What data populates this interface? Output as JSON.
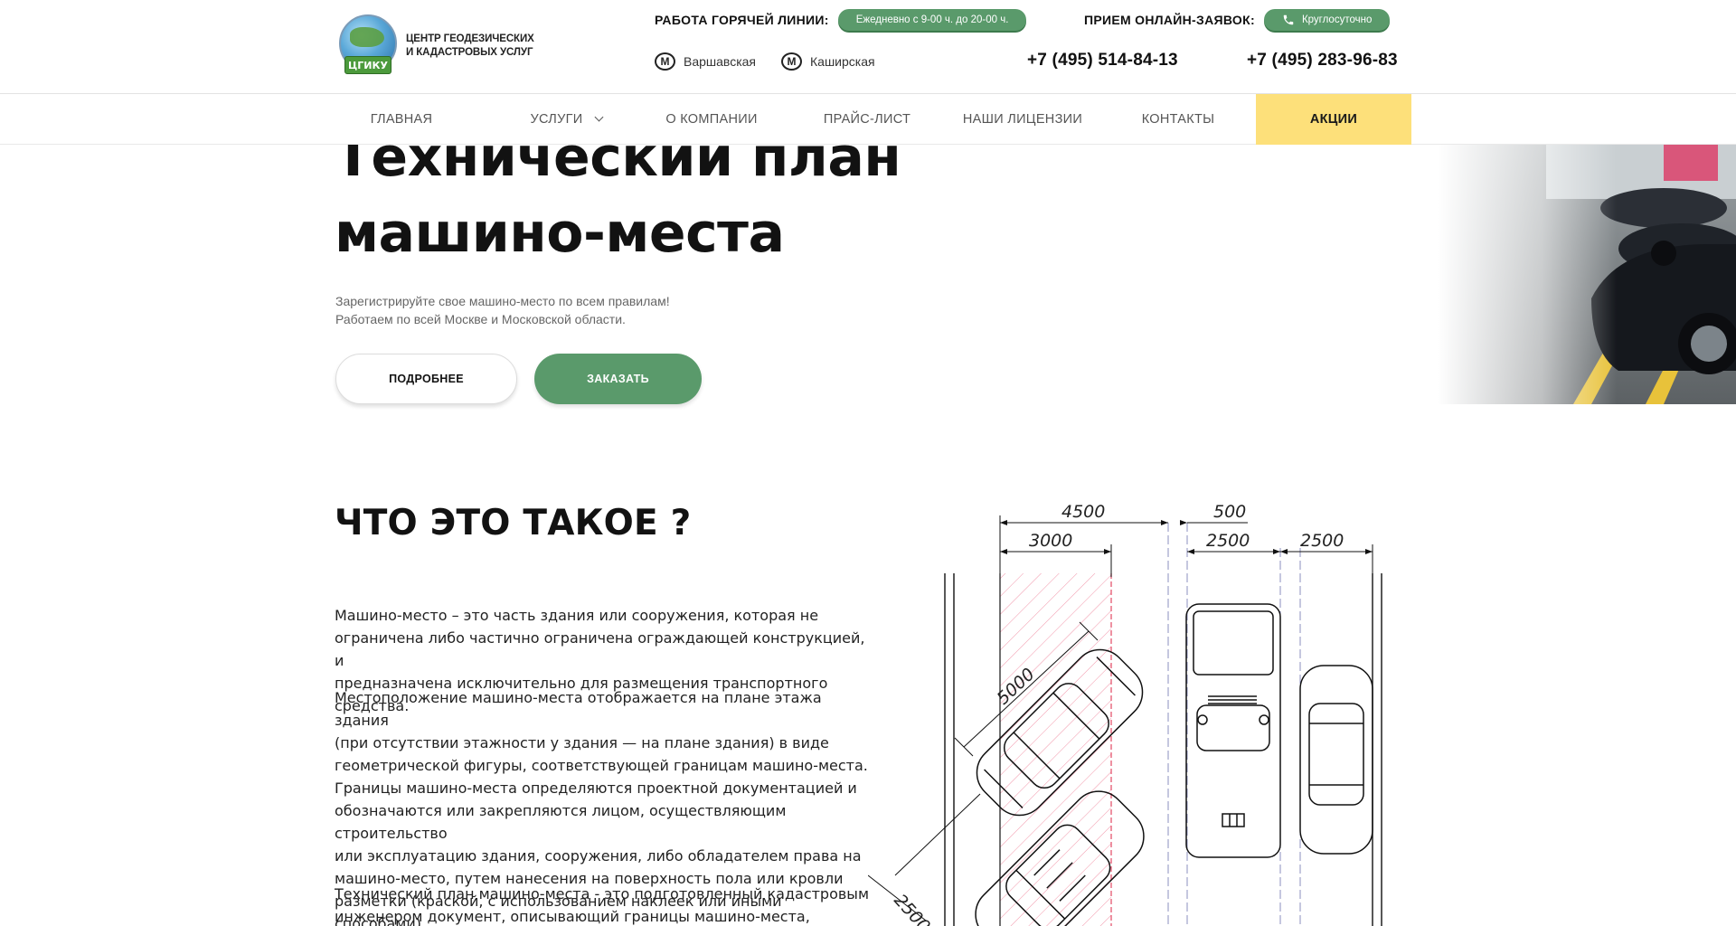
{
  "header": {
    "logo_line1": "ЦЕНТР ГЕОДЕЗИЧЕСКИХ",
    "logo_line2": "И КАДАСТРОВЫХ УСЛУГ",
    "logo_badge": "ЦГИКУ",
    "hotline_label": "РАБОТА ГОРЯЧЕЙ ЛИНИИ:",
    "hotline_hours": "Ежедневно с 9-00 ч. до 20-00 ч.",
    "online_label": "ПРИЕМ ОНЛАЙН-ЗАЯВОК:",
    "online_hours": "Круглосуточно",
    "metro": [
      {
        "icon": "metro-icon",
        "name": "Варшавская"
      },
      {
        "icon": "metro-icon",
        "name": "Каширская"
      }
    ],
    "phones": [
      "+7 (495) 514-84-13",
      "+7 (495) 283-96-83"
    ]
  },
  "nav": {
    "items": [
      "ГЛАВНАЯ",
      "УСЛУГИ",
      "О КОМПАНИИ",
      "ПРАЙС-ЛИСТ",
      "НАШИ ЛИЦЕНЗИИ",
      "КОНТАКТЫ",
      "АКЦИИ"
    ]
  },
  "hero": {
    "title_line1": "Технический план",
    "title_line2": "машино-места",
    "sub_line1": "Зарегистрируйте свое машино-место по всем правилам!",
    "sub_line2": "Работаем по всей Москве и Московской области.",
    "btn_more": "ПОДРОБНЕЕ",
    "btn_order": "ЗАКАЗАТЬ"
  },
  "section": {
    "title": "ЧТО ЭТО ТАКОЕ ?",
    "p1": [
      "Машино-место – это часть здания или сооружения, которая не",
      "ограничена либо частично ограничена ограждающей конструкцией, и",
      "предназначена исключительно для размещения транспортного средства."
    ],
    "p2": [
      "Местоположение машино-места отображается на плане этажа здания",
      "(при отсутствии этажности у здания — на плане здания) в виде",
      "геометрической фигуры, соответствующей границам машино-места.",
      "Границы машино-места определяются проектной документацией и",
      "обозначаются или закрепляются лицом, осуществляющим строительство",
      "или эксплуатацию здания, сооружения, либо обладателем права на",
      "машино-место, путем нанесения на поверхность пола или кровли",
      "разметки (краской, с использованием наклеек или иными способами)."
    ],
    "p3": [
      "Технический план машино-места - это подготовленный кадастровым",
      "инженером документ, описывающий границы машино-места, который"
    ]
  },
  "drawing": {
    "dims": [
      "4500",
      "500",
      "3000",
      "2500",
      "2500",
      "5000",
      "2500"
    ]
  },
  "colors": {
    "accent_green": "#5a9a6b",
    "promo_yellow": "#fde07a"
  }
}
